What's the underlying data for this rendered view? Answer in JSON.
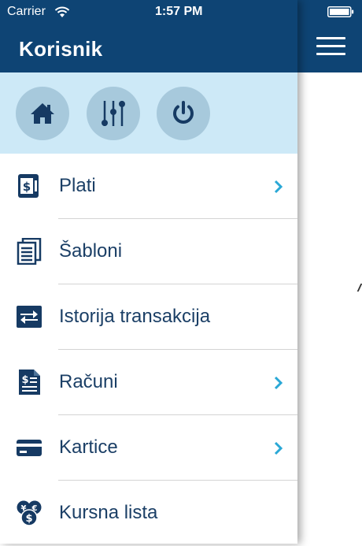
{
  "status_bar": {
    "carrier": "Carrier",
    "time": "1:57 PM"
  },
  "drawer": {
    "title": "Korisnik",
    "quick_actions": [
      {
        "icon": "home-icon"
      },
      {
        "icon": "sliders-icon"
      },
      {
        "icon": "power-icon"
      }
    ],
    "menu": [
      {
        "label": "Plati",
        "icon": "payment-tablet-icon",
        "has_chevron": true
      },
      {
        "label": "Šabloni",
        "icon": "templates-icon",
        "has_chevron": false
      },
      {
        "label": "Istorija transakcija",
        "icon": "transactions-icon",
        "has_chevron": false
      },
      {
        "label": "Računi",
        "icon": "bills-icon",
        "has_chevron": true
      },
      {
        "label": "Kartice",
        "icon": "card-icon",
        "has_chevron": true
      },
      {
        "label": "Kursna lista",
        "icon": "exchange-rate-icon",
        "has_chevron": false
      }
    ]
  },
  "colors": {
    "header": "#0e4474",
    "quick_bar": "#cde9f7",
    "quick_button": "#a7c9dc",
    "icon": "#163a63",
    "chevron": "#2aa8d6",
    "label": "#1b3f66"
  }
}
